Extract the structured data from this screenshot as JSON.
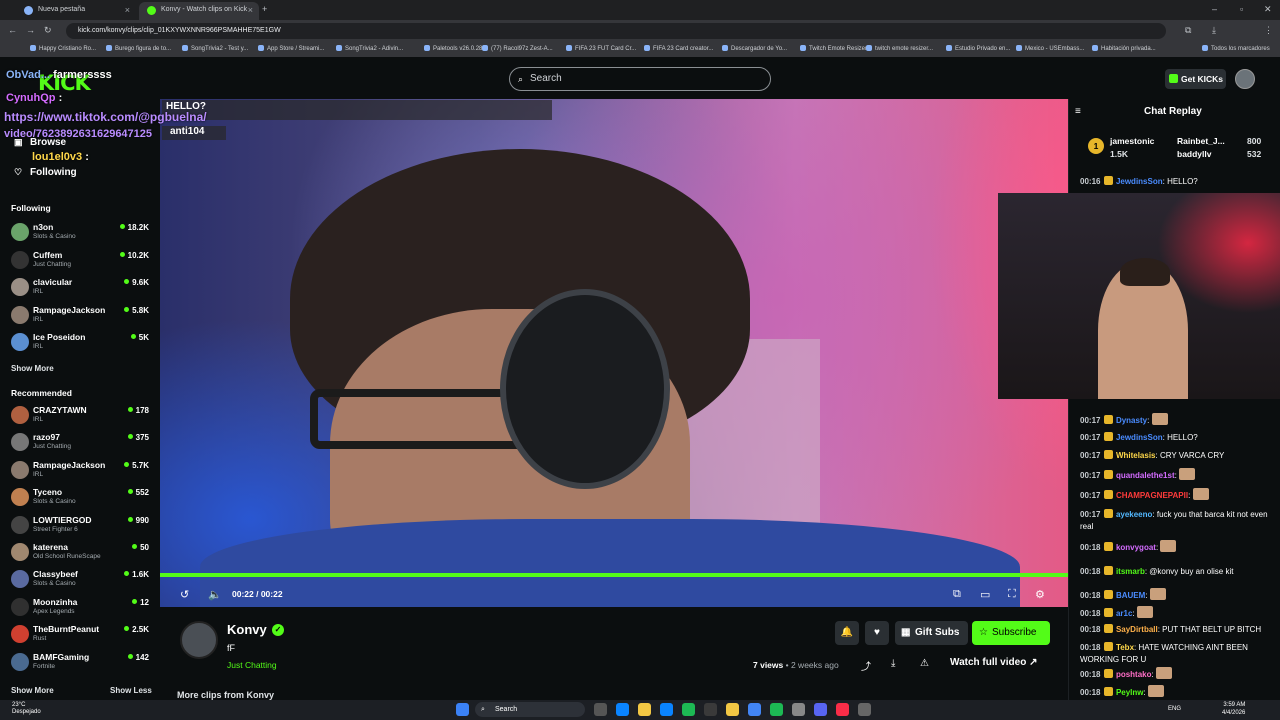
{
  "browser": {
    "tabs": [
      {
        "label": "Nueva pestaña",
        "color": "#8ab4f8"
      },
      {
        "label": "Konvy - Watch clips on Kick",
        "color": "#53fc18"
      }
    ],
    "url": "kick.com/konvy/clips/clip_01KXYWXNNR966PSMAHHE75E1GW",
    "bookmarks": [
      "Happy Cristiano Ro...",
      "Burego figura de to...",
      "SongTrivia2 - Test y...",
      "App Store / Streami...",
      "SongTrivia2 - Adivin...",
      "Paletools v26.0.28",
      "(77) Racol97z Zest-A...",
      "FIFA 23 FUT Card Cr...",
      "FIFA 23 Card creator...",
      "Descargador de Yo...",
      "Twitch Emote Resizer",
      "twitch emote resizer...",
      "Estudio Privado en...",
      "Mexico - USEmbass...",
      "Habitación privada..."
    ],
    "bookmarks_right": "Todos los marcadores"
  },
  "kick": {
    "logo": "KICK",
    "search_placeholder": "Search",
    "get_kicks": "Get KICKs"
  },
  "overlay_chat": [
    {
      "user": "ObVad...",
      "text": "farmerssss",
      "user_color": "#8ab4f8"
    },
    {
      "user": "CynuhQp",
      "text": ":",
      "user_color": "#d46cff"
    },
    {
      "user": "",
      "text": "https://www.tiktok.com/@pgbuelna/",
      "user_color": "#b98cff"
    },
    {
      "user": "",
      "text": "video/7623892631629647125",
      "user_color": "#b98cff"
    },
    {
      "user": "lou1el0v3",
      "text": ":",
      "user_color": "#ffd84a"
    }
  ],
  "sidebar": {
    "nav": [
      {
        "label": "Browse",
        "icon": "browse-icon"
      },
      {
        "label": "Following",
        "icon": "heart-icon"
      }
    ],
    "following_title": "Following",
    "following": [
      {
        "name": "n3on",
        "category": "Slots & Casino",
        "viewers": "18.2K",
        "color": "#6aa36a"
      },
      {
        "name": "Cuffem",
        "category": "Just Chatting",
        "viewers": "10.2K",
        "color": "#333333"
      },
      {
        "name": "clavicular",
        "category": "IRL",
        "viewers": "9.6K",
        "color": "#9a8f86"
      },
      {
        "name": "RampageJackson",
        "category": "IRL",
        "viewers": "5.8K",
        "color": "#8a7a6e"
      },
      {
        "name": "Ice Poseidon",
        "category": "IRL",
        "viewers": "5K",
        "color": "#5b8fd1"
      }
    ],
    "show_more_1": "Show More",
    "recommended_title": "Recommended",
    "recommended": [
      {
        "name": "CRAZYTAWN",
        "category": "IRL",
        "viewers": "178",
        "color": "#b06040"
      },
      {
        "name": "razo97",
        "category": "Just Chatting",
        "viewers": "375",
        "color": "#777777"
      },
      {
        "name": "RampageJackson",
        "category": "IRL",
        "viewers": "5.7K",
        "color": "#8a7a6e"
      },
      {
        "name": "Tyceno",
        "category": "Slots & Casino",
        "viewers": "552",
        "color": "#c08050"
      },
      {
        "name": "LOWTIERGOD",
        "category": "Street Fighter 6",
        "viewers": "990",
        "color": "#444444"
      },
      {
        "name": "katerena",
        "category": "Old School RuneScape",
        "viewers": "50",
        "color": "#a08870"
      },
      {
        "name": "Classybeef",
        "category": "Slots & Casino",
        "viewers": "1.6K",
        "color": "#5a6aa0"
      },
      {
        "name": "Moonzinha",
        "category": "Apex Legends",
        "viewers": "12",
        "color": "#303030"
      },
      {
        "name": "TheBurntPeanut",
        "category": "Rust",
        "viewers": "2.5K",
        "color": "#d04030"
      },
      {
        "name": "BAMFGaming",
        "category": "Fortnite",
        "viewers": "142",
        "color": "#4a6a90"
      }
    ],
    "show_more_2": "Show More",
    "show_less": "Show Less"
  },
  "video": {
    "caption_user": "HELLO?",
    "caption_user2": "anti104",
    "time": "00:22 / 00:22",
    "progress": 1.0
  },
  "clip": {
    "streamer": "Konvy",
    "title": "fF",
    "category": "Just Chatting",
    "gift_subs": "Gift Subs",
    "subscribe": "Subscribe",
    "views": "7 views",
    "age": "• 2 weeks ago",
    "watch_full": "Watch full video",
    "more_clips": "More clips from Konvy"
  },
  "chat": {
    "title": "Chat Replay",
    "top_gifters": [
      {
        "rank": "1",
        "name": "jamestonic",
        "amount": "1.5K"
      },
      {
        "rank": "",
        "name": "Rainbet_J...",
        "amount": "800"
      },
      {
        "rank": "",
        "name": "baddyllv",
        "amount": "532"
      }
    ],
    "messages": [
      {
        "time": "00:16",
        "user": "JewdinsSon",
        "text": ": HELLO?",
        "color": "#4a8cff"
      },
      {
        "time": "00:17",
        "user": "Dynasty",
        "text": ":",
        "color": "#4a8cff"
      },
      {
        "time": "00:17",
        "user": "JewdinsSon",
        "text": ": HELLO?",
        "color": "#4a8cff"
      },
      {
        "time": "00:17",
        "user": "Whitelasis",
        "text": ": CRY VARCA CRY",
        "color": "#ffd84a"
      },
      {
        "time": "00:17",
        "user": "quandalethe1st",
        "text": ":",
        "color": "#d46cff"
      },
      {
        "time": "00:17",
        "user": "CHAMPAGNEPAPII",
        "text": ":",
        "color": "#ff3b3b"
      },
      {
        "time": "00:17",
        "user": "ayekeeno",
        "text": ": fuck you that barca kit not even real",
        "color": "#53b8ff"
      },
      {
        "time": "00:18",
        "user": "konvygoat",
        "text": ":",
        "color": "#d46cff"
      },
      {
        "time": "00:18",
        "user": "itsmarb",
        "text": ": @konvy buy an olise kit",
        "color": "#53fc18"
      },
      {
        "time": "00:18",
        "user": "BAUEM",
        "text": ":",
        "color": "#4a8cff"
      },
      {
        "time": "00:18",
        "user": "ar1c",
        "text": ":",
        "color": "#4a8cff"
      },
      {
        "time": "00:18",
        "user": "SayDirtball",
        "text": ": PUT THAT BELT UP BITCH",
        "color": "#ffb14a"
      },
      {
        "time": "00:18",
        "user": "Tebx",
        "text": ": HATE WATCHING AINT BEEN WORKING FOR U",
        "color": "#ffd84a"
      },
      {
        "time": "00:18",
        "user": "poshtako",
        "text": ":",
        "color": "#ff6ec7"
      },
      {
        "time": "00:18",
        "user": "Peylnw",
        "text": ":",
        "color": "#53fc18"
      }
    ]
  },
  "taskbar": {
    "weather_temp": "23°C",
    "weather_desc": "Despejado",
    "search": "Search",
    "lang": "ENG",
    "time": "3:59 AM",
    "date": "4/4/2026"
  },
  "colors": {
    "accent": "#53fc18",
    "bg": "#0b0e0f"
  }
}
